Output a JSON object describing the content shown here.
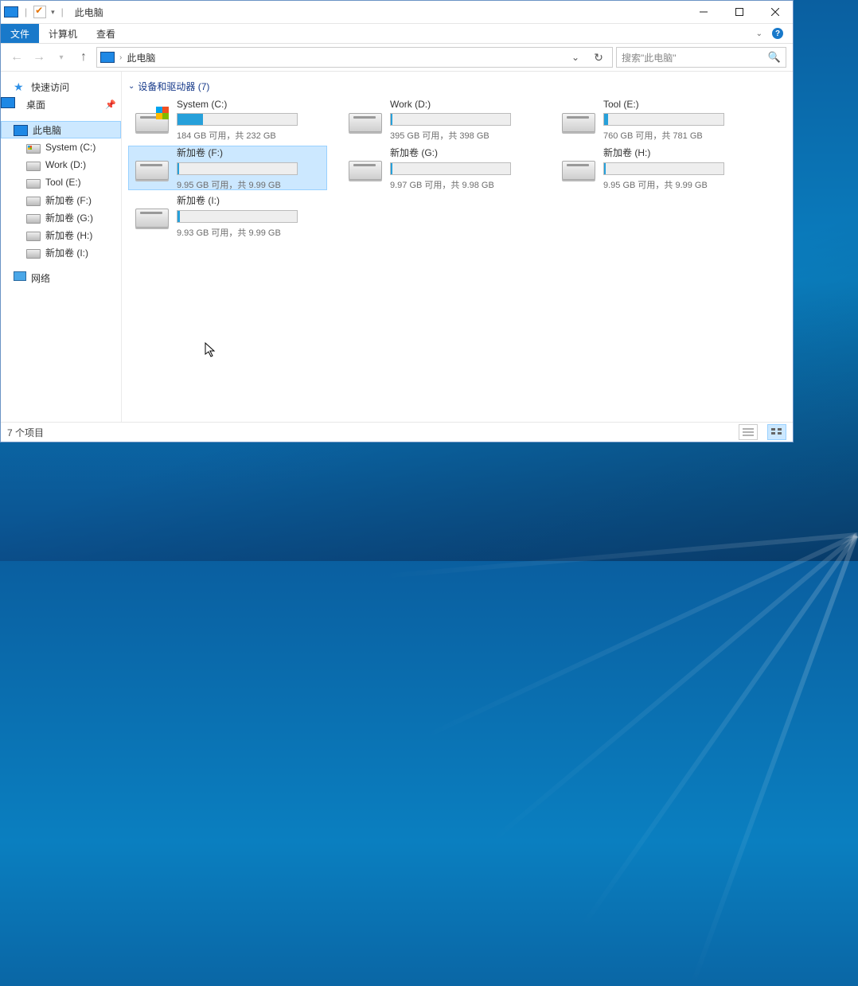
{
  "window": {
    "title": "此电脑",
    "quick_access_checked": true
  },
  "ribbon": {
    "file": "文件",
    "computer": "计算机",
    "view": "查看"
  },
  "address": {
    "location": "此电脑",
    "back_enabled": false,
    "forward_enabled": false,
    "search_placeholder": "搜索\"此电脑\""
  },
  "sidebar": {
    "quick_access": "快速访问",
    "desktop": "桌面",
    "this_pc": "此电脑",
    "drives": [
      {
        "label": "System (C:)",
        "win": true
      },
      {
        "label": "Work (D:)"
      },
      {
        "label": "Tool (E:)"
      },
      {
        "label": "新加卷 (F:)"
      },
      {
        "label": "新加卷 (G:)"
      },
      {
        "label": "新加卷 (H:)"
      },
      {
        "label": "新加卷 (I:)"
      }
    ],
    "network": "网络"
  },
  "group": {
    "title": "设备和驱动器 (7)"
  },
  "drives": [
    {
      "name": "System (C:)",
      "caption": "184 GB 可用，共 232 GB",
      "fill": 21,
      "win": true
    },
    {
      "name": "Work (D:)",
      "caption": "395 GB 可用，共 398 GB",
      "fill": 1
    },
    {
      "name": "Tool (E:)",
      "caption": "760 GB 可用，共 781 GB",
      "fill": 3
    },
    {
      "name": "新加卷 (F:)",
      "caption": "9.95 GB 可用，共 9.99 GB",
      "fill": 1,
      "selected": true
    },
    {
      "name": "新加卷 (G:)",
      "caption": "9.97 GB 可用，共 9.98 GB",
      "fill": 1
    },
    {
      "name": "新加卷 (H:)",
      "caption": "9.95 GB 可用，共 9.99 GB",
      "fill": 1
    },
    {
      "name": "新加卷 (I:)",
      "caption": "9.93 GB 可用，共 9.99 GB",
      "fill": 2
    }
  ],
  "status": {
    "text": "7 个项目"
  }
}
